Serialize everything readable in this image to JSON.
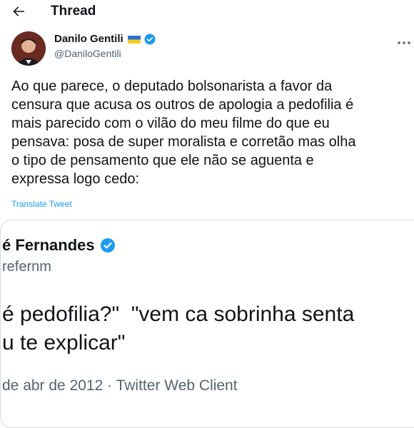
{
  "header": {
    "title": "Thread",
    "back_icon": "arrow-left-icon"
  },
  "tweet": {
    "author_name": "Danilo Gentili",
    "author_handle": "@DaniloGentili",
    "text": "Ao que parece, o deputado bolsonarista a favor da\ncensura que acusa os outros de apologia a pedofilia é\nmais parecido com o vilão do meu filme do que eu\npensava: posa de super moralista e corretão mas olha\no tipo de pensamento que ele não se aguenta e\nexpressa logo cedo:",
    "translate_label": "Translate Tweet",
    "more_icon": "more-dots-icon",
    "verified_icon": "verified-badge-icon",
    "flag_icon": "ukraine-flag-icon"
  },
  "quoted": {
    "name": "é Fernandes",
    "handle": "refernm",
    "text": "é pedofilia?\"  \"vem ca sobrinha senta\nu te explicar\"",
    "meta": "de abr de 2012 · Twitter Web Client"
  },
  "colors": {
    "accent": "#1d9bf0",
    "text": "#0f1419",
    "secondary": "#536471"
  }
}
